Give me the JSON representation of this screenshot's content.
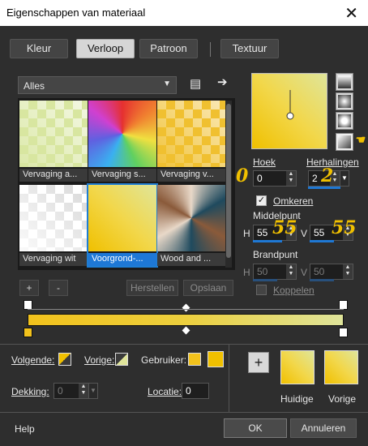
{
  "window": {
    "title": "Eigenschappen van materiaal"
  },
  "tabs": [
    {
      "label": "Kleur"
    },
    {
      "label": "Verloop"
    },
    {
      "label": "Patroon"
    },
    {
      "label": "Textuur"
    }
  ],
  "category": {
    "value": "Alles"
  },
  "gallery": {
    "items": [
      {
        "label": "Vervaging a...",
        "colors": [
          "#d8e6a0",
          "#ffffff"
        ]
      },
      {
        "label": "Vervaging s...",
        "colors": [
          "#e53030",
          "#3ab0f0",
          "#f0e040",
          "#ffffff"
        ]
      },
      {
        "label": "Vervaging v...",
        "colors": [
          "#f0c030",
          "#ffffff"
        ]
      },
      {
        "label": "Vervaging wit",
        "colors": [
          "#ffffff",
          "#d0d0d0"
        ]
      },
      {
        "label": "Voorgrond-...",
        "colors": [
          "#f0c000",
          "#dfe59a"
        ]
      },
      {
        "label": "Wood and ...",
        "colors": [
          "#1f4a5e",
          "#8a5a3a",
          "#e8d8c8"
        ]
      }
    ],
    "selected": "Voorgrond-..."
  },
  "gallery_buttons": {
    "add": "+",
    "remove": "-",
    "restore": "Herstellen",
    "save": "Opslaan"
  },
  "angle": {
    "label": "Hoek",
    "value": "0",
    "annotation": "0"
  },
  "repeats": {
    "label": "Herhalingen",
    "value": "2",
    "annotation": "2"
  },
  "invert": {
    "label": "Omkeren",
    "checked": true
  },
  "midpoint": {
    "label": "Middelpunt",
    "h_label": "H",
    "h_value": "55",
    "v_label": "V",
    "v_value": "55",
    "h_annotation": "55",
    "v_annotation": "55"
  },
  "focus": {
    "label": "Brandpunt",
    "h_label": "H",
    "h_value": "50",
    "v_label": "V",
    "v_value": "50"
  },
  "link": {
    "label": "Koppelen",
    "checked": false
  },
  "stops": {
    "next_label": "Volgende:",
    "prev_label": "Vorige:",
    "user_label": "Gebruiker:",
    "opacity_label": "Dekking:",
    "opacity_value": "0",
    "location_label": "Locatie:",
    "location_value": "0",
    "user_color": "#f2c21c",
    "user_color2": "#f0c000"
  },
  "swatches": {
    "current_label": "Huidige",
    "previous_label": "Vorige",
    "add_label": "+"
  },
  "footer": {
    "help": "Help",
    "ok": "OK",
    "cancel": "Annuleren"
  },
  "colors": {
    "accent": "#1f78d4",
    "yellow": "#f0c000",
    "light_green": "#dfe49a",
    "annotation": "#f0c000"
  }
}
